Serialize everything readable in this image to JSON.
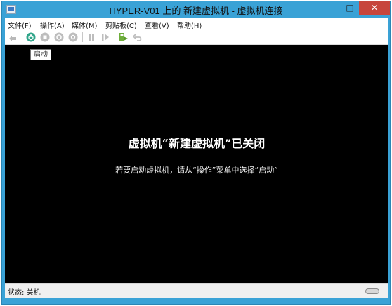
{
  "window": {
    "title": "HYPER-V01 上的 新建虚拟机 - 虚拟机连接",
    "controls": {
      "minimize": "–",
      "maximize": "□",
      "close": "✕"
    }
  },
  "menubar": {
    "items": [
      "文件(F)",
      "操作(A)",
      "媒体(M)",
      "剪贴板(C)",
      "查看(V)",
      "帮助(H)"
    ]
  },
  "toolbar": {
    "tooltip": "启动",
    "icons": [
      "ctrl-alt-del-icon",
      "start-icon",
      "turn-off-icon",
      "shutdown-icon",
      "save-state-icon",
      "pause-icon",
      "reset-icon",
      "snapshot-icon",
      "revert-icon"
    ]
  },
  "screen": {
    "title": "虚拟机“新建虚拟机”已关闭",
    "subtitle": "若要启动虚拟机，请从“操作”菜单中选择“启动”"
  },
  "statusbar": {
    "status": "状态: 关机"
  },
  "colors": {
    "frame": "#3aa2d6",
    "close_button": "#c7463c",
    "start_icon": "#2fa58a",
    "screen": "#000000"
  }
}
